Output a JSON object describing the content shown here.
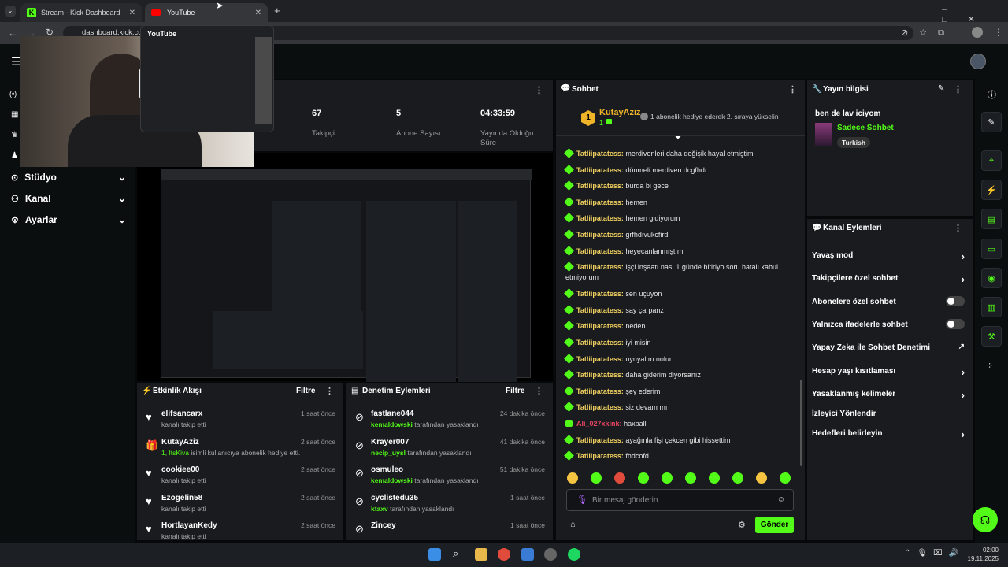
{
  "browser": {
    "tabs": [
      {
        "label": "Stream - Kick Dashboard"
      },
      {
        "label": "YouTube"
      }
    ],
    "url": "dashboard.kick.co",
    "hover_title": "YouTube"
  },
  "sidebar": {
    "items": [
      {
        "label": "Stüdyo"
      },
      {
        "label": "Kanal"
      },
      {
        "label": "Ayarlar"
      }
    ]
  },
  "stats": [
    {
      "value": "67",
      "label": "Takipçi"
    },
    {
      "value": "5",
      "label": "Abone Sayısı"
    },
    {
      "value": "04:33:59",
      "label": "Yayında Olduğu Süre"
    }
  ],
  "activity": {
    "title": "Etkinlik Akışı",
    "filter": "Filtre",
    "items": [
      {
        "name": "elifsancarx",
        "sub": "kanalı takip etti",
        "time": "1 saat önce",
        "icon": "heart-icon"
      },
      {
        "name": "KutayAziz",
        "sub_hl": "1, ItsKiva",
        "sub": "isimli kullanıcıya abonelik hediye etti.",
        "time": "2 saat önce",
        "icon": "gift-icon"
      },
      {
        "name": "cookiee00",
        "sub": "kanalı takip etti",
        "time": "2 saat önce",
        "icon": "heart-icon"
      },
      {
        "name": "Ezogelin58",
        "sub": "kanalı takip etti",
        "time": "2 saat önce",
        "icon": "heart-icon"
      },
      {
        "name": "HortlayanKedy",
        "sub": "kanalı takip etti",
        "time": "2 saat önce",
        "icon": "heart-icon"
      }
    ]
  },
  "moderation": {
    "title": "Denetim Eylemleri",
    "filter": "Filtre",
    "items": [
      {
        "name": "fastlane044",
        "by": "kemaldowski",
        "sub": "tarafından yasaklandı",
        "time": "24 dakika önce"
      },
      {
        "name": "Krayer007",
        "by": "necip_uysl",
        "sub": "tarafından yasaklandı",
        "time": "41 dakika önce"
      },
      {
        "name": "osmuleo",
        "by": "kemaldowski",
        "sub": "tarafından yasaklandı",
        "time": "51 dakika önce"
      },
      {
        "name": "cyclistedu35",
        "by": "ktaxv",
        "sub": "tarafından yasaklandı",
        "time": "1 saat önce"
      },
      {
        "name": "Zincey",
        "by": "",
        "sub": "",
        "time": "1 saat önce"
      }
    ]
  },
  "chat": {
    "title": "Sohbet",
    "pinned": {
      "rank": "1",
      "user": "KutayAziz",
      "count": "1",
      "text": "1 abonelik hediye ederek 2. sıraya yükselin"
    },
    "messages": [
      {
        "user": "Tatliipatatess:",
        "text": "merdivenleri daha değişik hayal etmiştim"
      },
      {
        "user": "Tatliipatatess:",
        "text": "dönmeli merdiven dcgfhdı"
      },
      {
        "user": "Tatliipatatess:",
        "text": "burda bi gece"
      },
      {
        "user": "Tatliipatatess:",
        "text": "hemen"
      },
      {
        "user": "Tatliipatatess:",
        "text": "hemen gidiyorum"
      },
      {
        "user": "Tatliipatatess:",
        "text": "grfhdıvukcfird"
      },
      {
        "user": "Tatliipatatess:",
        "text": "heyecanlanmıştım"
      },
      {
        "user": "Tatliipatatess:",
        "text": "işçi inşaatı nası 1 günde bitiriyo soru hatalı kabul etmiyorum"
      },
      {
        "user": "Tatliipatatess:",
        "text": "sen uçuyon"
      },
      {
        "user": "Tatliipatatess:",
        "text": "say çarpanz"
      },
      {
        "user": "Tatliipatatess:",
        "text": "neden"
      },
      {
        "user": "Tatliipatatess:",
        "text": "iyi misin"
      },
      {
        "user": "Tatliipatatess:",
        "text": "uyuyalım nolur"
      },
      {
        "user": "Tatliipatatess:",
        "text": "daha giderim diyorsanız"
      },
      {
        "user": "Tatliipatatess:",
        "text": "şey ederim"
      },
      {
        "user": "Tatliipatatess:",
        "text": "siz devam mı"
      },
      {
        "user": "Ali_027xkink:",
        "text": "haxball"
      },
      {
        "user": "Tatliipatatess:",
        "text": "ayağınla fişi çekcen gibi hissettim"
      },
      {
        "user": "Tatliipatatess:",
        "text": "fhdcofd"
      }
    ],
    "placeholder": "Bir mesaj gönderin",
    "send": "Gönder"
  },
  "stream_info": {
    "title": "Yayın bilgisi",
    "stream_title": "ben de lav iciyom",
    "category": "Sadece Sohbet",
    "tag": "Turkish"
  },
  "channel_actions": {
    "title": "Kanal Eylemleri",
    "items": [
      {
        "label": "Yavaş mod",
        "type": "chevron"
      },
      {
        "label": "Takipçilere özel sohbet",
        "type": "chevron"
      },
      {
        "label": "Abonelere özel sohbet",
        "type": "toggle"
      },
      {
        "label": "Yalnızca ifadelerle sohbet",
        "type": "toggle"
      },
      {
        "label": "Yapay Zeka ile Sohbet Denetimi",
        "type": "external"
      },
      {
        "label": "Hesap yaşı kısıtlaması",
        "type": "chevron"
      },
      {
        "label": "Yasaklanmış kelimeler",
        "type": "chevron"
      },
      {
        "label": "İzleyici Yönlendir",
        "type": "none"
      },
      {
        "label": "Hedefleri belirleyin",
        "type": "chevron"
      }
    ]
  },
  "taskbar": {
    "time": "02:00",
    "date": "19.11.2025"
  }
}
